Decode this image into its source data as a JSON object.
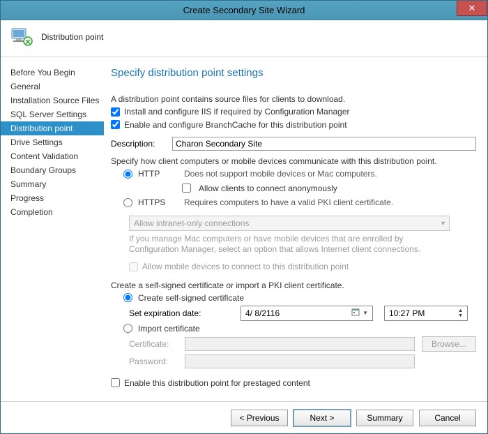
{
  "window": {
    "title": "Create Secondary Site Wizard"
  },
  "header": {
    "title": "Distribution point"
  },
  "sidebar": {
    "items": [
      {
        "label": "Before You Begin",
        "selected": false
      },
      {
        "label": "General",
        "selected": false
      },
      {
        "label": "Installation Source Files",
        "selected": false
      },
      {
        "label": "SQL Server Settings",
        "selected": false
      },
      {
        "label": "Distribution point",
        "selected": true
      },
      {
        "label": "Drive Settings",
        "selected": false
      },
      {
        "label": "Content Validation",
        "selected": false
      },
      {
        "label": "Boundary Groups",
        "selected": false
      },
      {
        "label": "Summary",
        "selected": false
      },
      {
        "label": "Progress",
        "selected": false
      },
      {
        "label": "Completion",
        "selected": false
      }
    ]
  },
  "main": {
    "heading": "Specify distribution point settings",
    "intro": "A distribution point contains source files for clients to download.",
    "iis_checkbox": "Install and configure IIS if required by Configuration Manager",
    "branchcache_checkbox": "Enable and configure BranchCache for this distribution point",
    "description_label": "Description:",
    "description_value": "Charon Secondary Site",
    "protocol_intro": "Specify how client computers or mobile devices communicate with this distribution point.",
    "http": {
      "label": "HTTP",
      "hint": "Does not support mobile devices or Mac computers.",
      "anonymous": "Allow clients to connect anonymously"
    },
    "https": {
      "label": "HTTPS",
      "hint": "Requires computers to have a valid PKI client certificate."
    },
    "connections_combo": "Allow intranet-only connections",
    "connections_note": "If you manage Mac computers or have mobile devices that are enrolled by Configuration Manager, select an option that allows Internet client connections.",
    "mobile_connect_checkbox": "Allow mobile devices to connect to this distribution point",
    "cert_intro": "Create a self-signed certificate or import a PKI client certificate.",
    "self_signed_label": "Create self-signed certificate",
    "expiration_label": "Set expiration date:",
    "expiration_date": "4/  8/2116",
    "expiration_time": "10:27 PM",
    "import_label": "Import certificate",
    "certificate_label": "Certificate:",
    "password_label": "Password:",
    "browse_button": "Browse...",
    "prestaged_checkbox": "Enable this distribution point for prestaged content"
  },
  "footer": {
    "previous": "< Previous",
    "next": "Next >",
    "summary": "Summary",
    "cancel": "Cancel"
  }
}
